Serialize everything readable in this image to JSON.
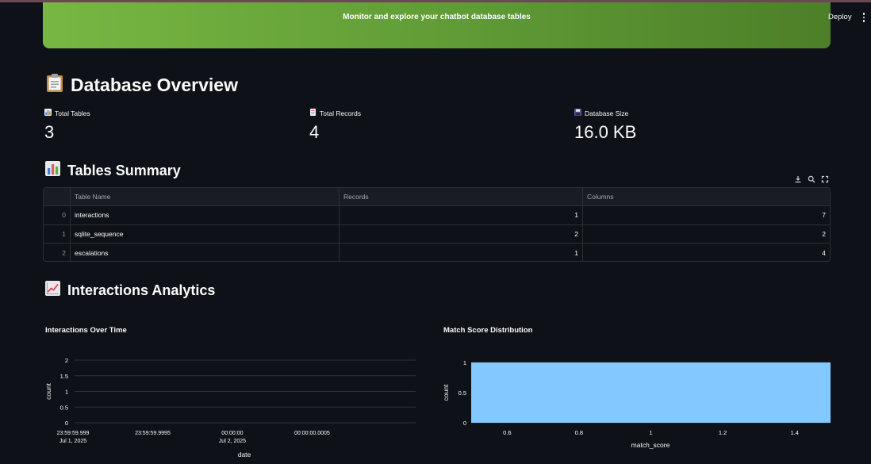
{
  "header": {
    "subtitle": "Monitor and explore your chatbot database tables",
    "deploy_label": "Deploy",
    "menu_icon": "more-vertical-icon",
    "accent_colors": [
      "#78b743",
      "#4d7f28"
    ]
  },
  "overview": {
    "title": "Database Overview",
    "icon": "clipboard-icon",
    "metrics": [
      {
        "label": "Total Tables",
        "value": "3",
        "icon": "bar-chart-icon"
      },
      {
        "label": "Total Records",
        "value": "4",
        "icon": "page-icon"
      },
      {
        "label": "Database Size",
        "value": "16.0 KB",
        "icon": "floppy-disk-icon"
      }
    ]
  },
  "summary": {
    "title": "Tables Summary",
    "icon": "bar-chart-icon",
    "tools": [
      "download-icon",
      "search-icon",
      "fullscreen-icon"
    ],
    "columns": [
      "Table Name",
      "Records",
      "Columns"
    ],
    "rows": [
      {
        "index": "0",
        "name": "interactions",
        "records": "1",
        "columns": "7"
      },
      {
        "index": "1",
        "name": "sqlite_sequence",
        "records": "2",
        "columns": "2"
      },
      {
        "index": "2",
        "name": "escalations",
        "records": "1",
        "columns": "4"
      }
    ]
  },
  "analytics": {
    "title": "Interactions Analytics",
    "icon": "chart-increasing-icon"
  },
  "chart_data": [
    {
      "type": "line",
      "title": "Interactions Over Time",
      "xlabel": "date",
      "ylabel": "count",
      "ylim": [
        0,
        2
      ],
      "y_ticks": [
        "0",
        "0.5",
        "1",
        "1.5",
        "2"
      ],
      "x_ticks": [
        {
          "label": "23:59:59.999",
          "sub": "Jul 1, 2025"
        },
        {
          "label": "23:59:59.9995",
          "sub": ""
        },
        {
          "label": "00:00:00",
          "sub": "Jul 2, 2025"
        },
        {
          "label": "00:00:00.0005",
          "sub": ""
        }
      ],
      "series": [],
      "grid": true
    },
    {
      "type": "bar",
      "title": "Match Score Distribution",
      "xlabel": "match_score",
      "ylabel": "count",
      "ylim": [
        0,
        1
      ],
      "xlim": [
        0.5,
        1.5
      ],
      "y_ticks": [
        "0",
        "0.5",
        "1"
      ],
      "x_ticks": [
        "0.6",
        "0.8",
        "1",
        "1.2",
        "1.4"
      ],
      "bins": [
        {
          "x0": 0.5,
          "x1": 1.5,
          "count": 1
        }
      ],
      "bar_color": "#83c9ff",
      "grid": true
    }
  ]
}
